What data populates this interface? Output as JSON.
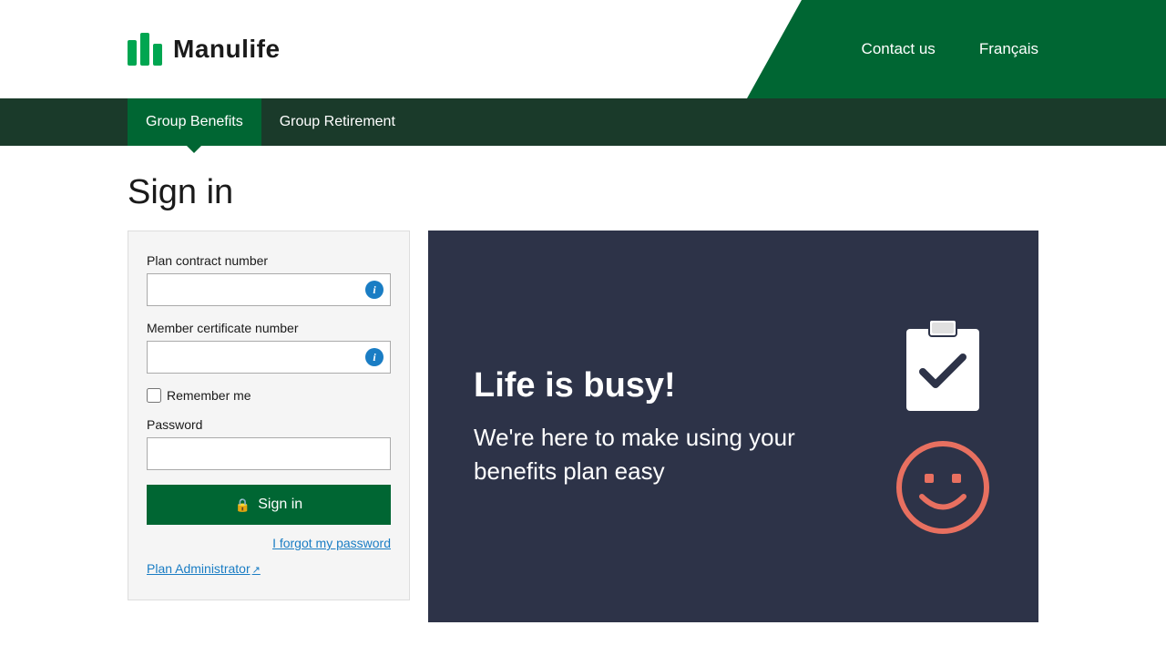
{
  "header": {
    "logo_text": "Manulife",
    "contact_label": "Contact us",
    "language_label": "Français"
  },
  "nav": {
    "tabs": [
      {
        "id": "group-benefits",
        "label": "Group Benefits",
        "active": true
      },
      {
        "id": "group-retirement",
        "label": "Group Retirement",
        "active": false
      }
    ]
  },
  "signin": {
    "page_title": "Sign in",
    "plan_contract_label": "Plan contract number",
    "member_cert_label": "Member certificate number",
    "remember_me_label": "Remember me",
    "password_label": "Password",
    "signin_button_label": "Sign in",
    "forgot_password_label": "I forgot my password",
    "plan_admin_label": "Plan Administrator"
  },
  "promo": {
    "title": "Life is busy!",
    "subtitle": "We're here to make using your benefits plan easy"
  }
}
